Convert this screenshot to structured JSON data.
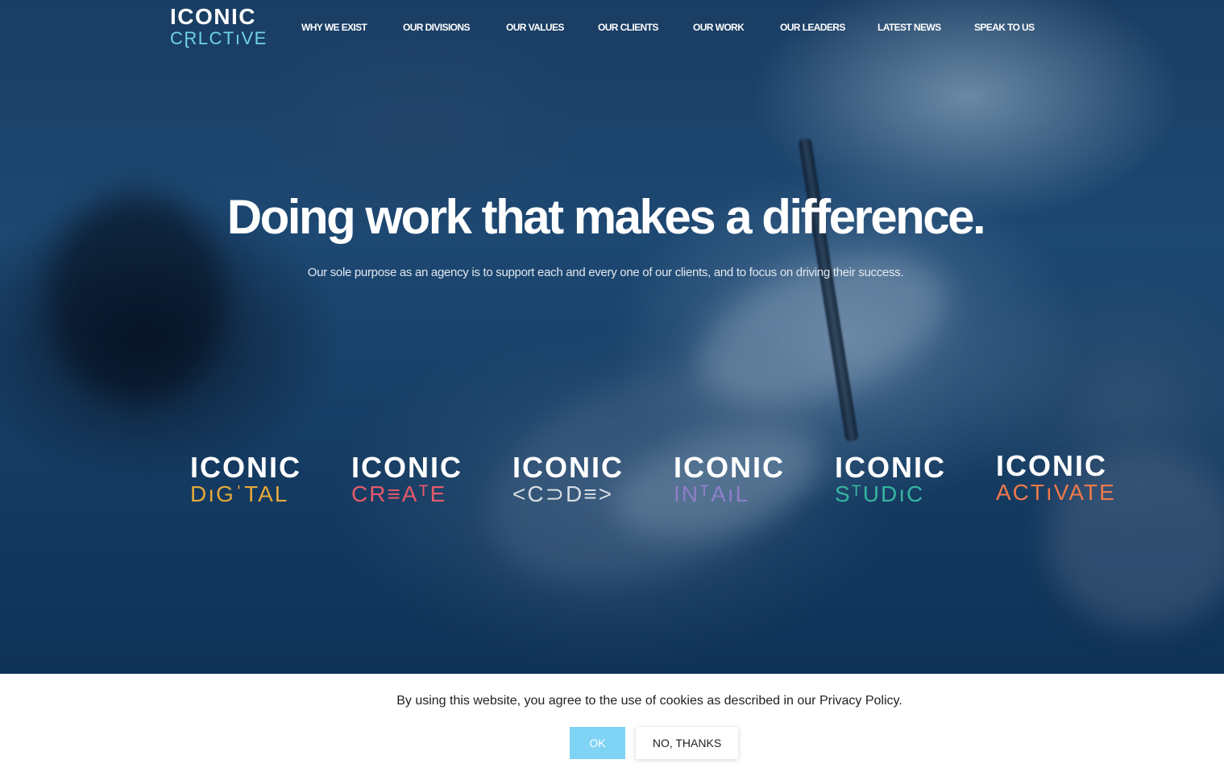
{
  "header": {
    "logo_top": "ICONIC",
    "logo_bottom": "CⱤLCTıVE"
  },
  "nav": [
    "WHY WE EXIST",
    "OUR DIVISIONS",
    "OUR VALUES",
    "OUR CLIENTS",
    "OUR WORK",
    "OUR LEADERS",
    "LATEST NEWS",
    "SPEAK TO US"
  ],
  "hero": {
    "headline": "Doing work that makes a difference.",
    "subheadline": "Our sole purpose as an agency is to support each and every one of our clients, and to focus on driving their success."
  },
  "divisions": [
    {
      "top": "ICONIC",
      "bottom": "DıGˈTAL",
      "color": "#e6a83a"
    },
    {
      "top": "ICONIC",
      "bottom": "CR≡AᵀE",
      "color": "#e8596a"
    },
    {
      "top": "ICONIC",
      "bottom": "<C⊃D≡>",
      "color": "#d8dde3"
    },
    {
      "top": "ICONIC",
      "bottom": "INᵀAıL",
      "color": "#8f7fc9"
    },
    {
      "top": "ICONIC",
      "bottom": "SᵀUDıC",
      "color": "#35b59f"
    },
    {
      "top": "ICONIC",
      "bottom": "ACTıVATE",
      "color": "#f07a4a"
    }
  ],
  "cookie": {
    "text": "By using this website, you agree to the use of cookies as described in our Privacy Policy.",
    "ok_label": "OK",
    "decline_label": "NO, THANKS"
  },
  "colors": {
    "logo_accent": "#6fd2e8",
    "ok_button": "#7fd3f4"
  }
}
